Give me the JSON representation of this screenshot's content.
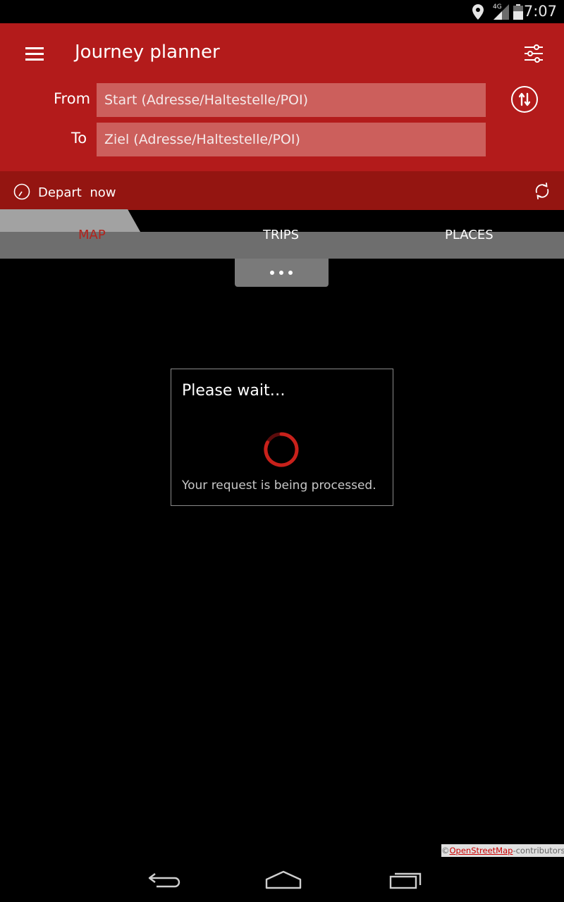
{
  "status_bar": {
    "time": "7:07",
    "network_label": "4G",
    "icons": [
      "location-icon",
      "signal-icon",
      "battery-icon"
    ]
  },
  "header": {
    "title": "Journey planner",
    "menu_icon": "menu-icon",
    "filter_icon": "filter-icon"
  },
  "form": {
    "from_label": "From",
    "to_label": "To",
    "from_placeholder": "Start (Adresse/Haltestelle/POI)",
    "to_placeholder": "Ziel (Adresse/Haltestelle/POI)",
    "from_value": "",
    "to_value": "",
    "swap_icon": "swap-icon"
  },
  "depart": {
    "label": "Depart",
    "value": "now"
  },
  "tabs": [
    {
      "label": "MAP",
      "active": true
    },
    {
      "label": "TRIPS",
      "active": false
    },
    {
      "label": "PLACES",
      "active": false
    }
  ],
  "dialog": {
    "title": "Please wait…",
    "message": "Your request is being processed."
  },
  "attribution": {
    "prefix": "©",
    "link": "OpenStreetMap",
    "suffix": "-contributors"
  },
  "nav": {
    "icons": [
      "back-icon",
      "home-icon",
      "recents-icon"
    ]
  },
  "colors": {
    "app_bar": "#b31b1b",
    "depart_bar": "#941511",
    "field_bg": "#cc5f5c",
    "tab_bar": "#707070",
    "active_tab_text": "#b3231c"
  }
}
